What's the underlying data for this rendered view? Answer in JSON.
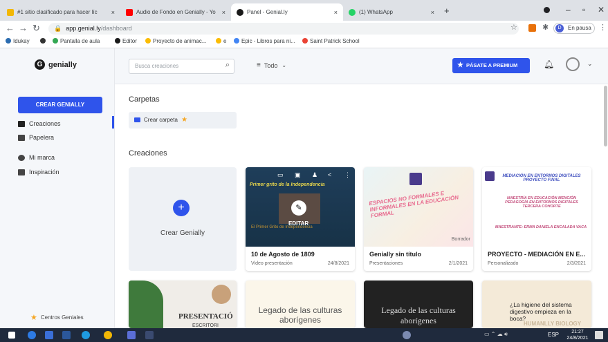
{
  "browser": {
    "tabs": [
      {
        "title": "#1 sitio clasificado para hacer líc",
        "close": "×",
        "color": "#f2b705"
      },
      {
        "title": "Audio de Fondo en Genially - Yo",
        "close": "×",
        "color": "#ff0000"
      },
      {
        "title": "Panel - Genial.ly",
        "close": "×",
        "color": "#1a1a1a"
      },
      {
        "title": "(1) WhatsApp",
        "close": "×",
        "color": "#25d366"
      }
    ],
    "new_tab": "+",
    "url_host": "app.genial.ly",
    "url_path": "/dashboard",
    "profile_label": "En pausa",
    "profile_initial": "D",
    "bookmarks": [
      {
        "label": "Idukay",
        "color": "#2b6cb0"
      },
      {
        "label": "",
        "color": "#333333"
      },
      {
        "label": "Pantalla de aula",
        "color": "#34a853"
      },
      {
        "label": "Editor",
        "color": "#1a1a1a"
      },
      {
        "label": "Proyecto de animac...",
        "color": "#fbbc04"
      },
      {
        "label": "e",
        "color": "#fbbc04"
      },
      {
        "label": "Epic - Libros para ni...",
        "color": "#4285f4"
      },
      {
        "label": "Saint Patrick School",
        "color": "#ea4335"
      }
    ]
  },
  "app": {
    "logo_text": "genially",
    "create_button": "CREAR GENIALLY",
    "nav": [
      {
        "label": "Creaciones",
        "active": true
      },
      {
        "label": "Papelera",
        "active": false
      },
      {
        "label": "Mi marca",
        "active": false
      },
      {
        "label": "Inspiración",
        "active": false
      }
    ],
    "centros": "Centros Geniales",
    "search_placeholder": "Busca creaciones",
    "filter_label": "Todo",
    "premium_button": "PÁSATE A PREMIUM",
    "folders_heading": "Carpetas",
    "create_folder": "Crear carpeta",
    "creations_heading": "Creaciones",
    "create_card_label": "Crear Genially",
    "cards": [
      {
        "title": "10 de Agosto de 1809",
        "type": "Video presentación",
        "date": "24/8/2021",
        "overlay_button": "EDITAR",
        "thumb_title": "Primer grito de la Independencia",
        "thumb_sub": "El Primer Grito de Independencia"
      },
      {
        "title": "Genially sin título",
        "type": "Presentaciones",
        "date": "2/1/2021",
        "badge": "Borrador",
        "thumb_title": "ESPACIOS NO FORMALES E INFORMALES EN LA EDUCACIÓN FORMAL"
      },
      {
        "title": "PROYECTO - MEDIACIÓN EN E...",
        "type": "Personalizado",
        "date": "2/3/2021",
        "thumb_title": "MEDIACIÓN EN ENTORNOS DIGITALES PROYECTO FINAL",
        "thumb_sub": "MAESTRÍA EN EDUCACIÓN MENCIÓN PEDAGOGÍA EN ENTORNOS DIGITALES TERCERA COHORTE",
        "thumb_author": "MAESTRANTE: ERMA DANIELA ENCALADA VACA"
      }
    ],
    "row2": [
      {
        "text": "PRESENTACIÓ",
        "sub": "ESCRITORI"
      },
      {
        "text": "Legado de las culturas aborígenes"
      },
      {
        "text": "Legado de las culturas aborígenes"
      },
      {
        "text": "¿La higiene del sistema digestivo empieza en la boca?",
        "sub": "HUMANLLY BIOLOGY"
      }
    ]
  },
  "taskbar": {
    "lang": "ESP",
    "time": "21:27",
    "date": "24/8/2021"
  },
  "colors": {
    "brand_blue": "#2f54eb",
    "sidebar_bg": "#f5f7fa"
  }
}
